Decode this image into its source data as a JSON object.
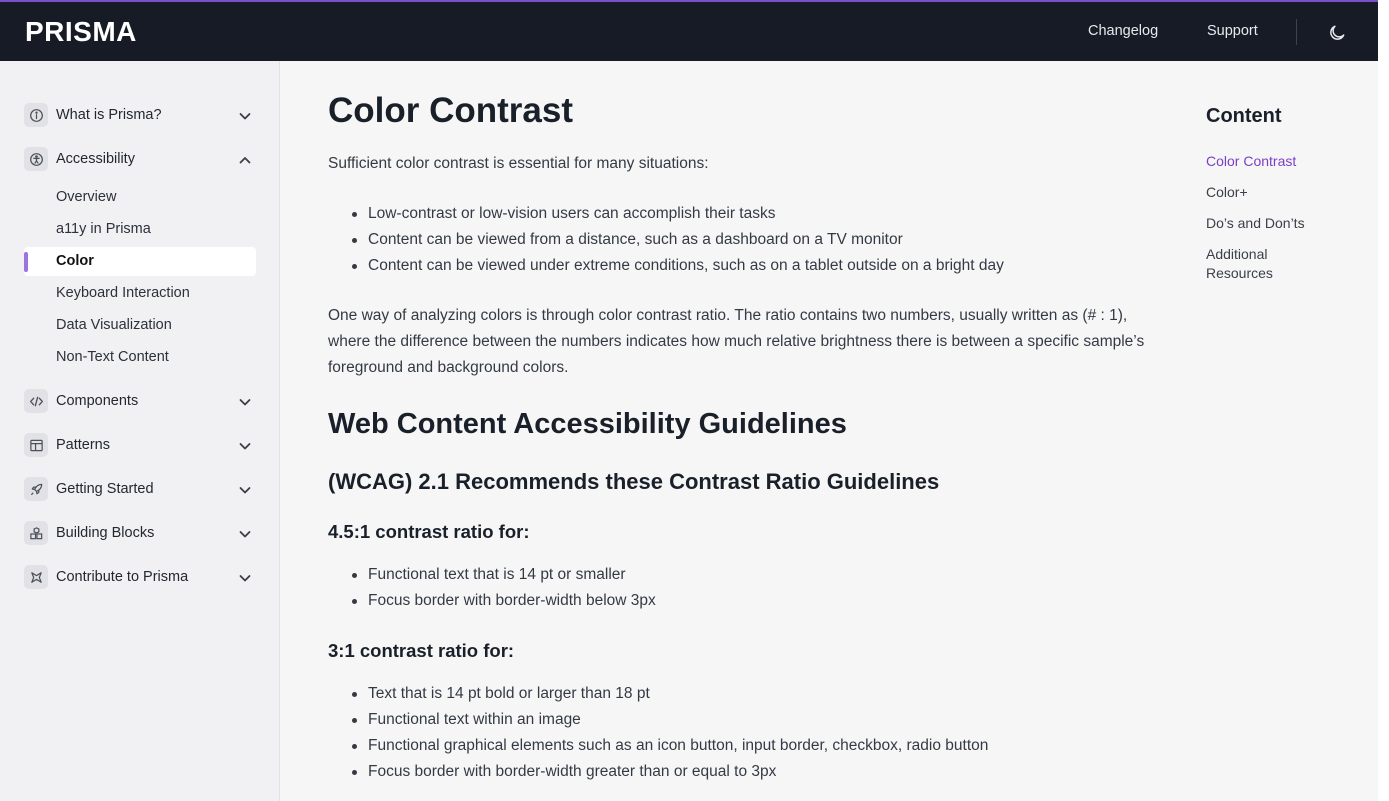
{
  "header": {
    "logo": "PRISMA",
    "links": [
      "Changelog",
      "Support"
    ],
    "theme_toggle_icon": "moon-icon"
  },
  "sidebar": {
    "groups": [
      {
        "label": "What is Prisma?",
        "icon": "info-icon",
        "expanded": false
      },
      {
        "label": "Accessibility",
        "icon": "accessibility-icon",
        "expanded": true
      },
      {
        "label": "Components",
        "icon": "code-icon",
        "expanded": false
      },
      {
        "label": "Patterns",
        "icon": "layout-icon",
        "expanded": false
      },
      {
        "label": "Getting Started",
        "icon": "rocket-icon",
        "expanded": false
      },
      {
        "label": "Building Blocks",
        "icon": "blocks-icon",
        "expanded": false
      },
      {
        "label": "Contribute to Prisma",
        "icon": "contribute-icon",
        "expanded": false
      }
    ],
    "accessibility_items": [
      "Overview",
      "a11y in Prisma",
      "Color",
      "Keyboard Interaction",
      "Data Visualization",
      "Non-Text Content"
    ],
    "active_item": "Color"
  },
  "main": {
    "title": "Color Contrast",
    "intro": "Sufficient color contrast is essential for many situations:",
    "situations": [
      "Low-contrast or low-vision users can accomplish their tasks",
      "Content can be viewed from a distance, such as a dashboard on a TV monitor",
      "Content can be viewed under extreme conditions, such as on a tablet outside on a bright day"
    ],
    "ratio_paragraph": "One way of analyzing colors is through color contrast ratio. The ratio contains two numbers, usually written as (# : 1), where the difference between the numbers indicates how much relative brightness there is between a specific sample’s foreground and background colors.",
    "wcag_heading": "Web Content Accessibility Guidelines",
    "wcag_subheading": "(WCAG) 2.1 Recommends these Contrast Ratio Guidelines",
    "ratio_45": {
      "heading": "4.5:1 contrast ratio for:",
      "items": [
        "Functional text that is 14 pt or smaller",
        "Focus border with border-width below 3px"
      ]
    },
    "ratio_3": {
      "heading": "3:1 contrast ratio for:",
      "items": [
        "Text that is 14 pt bold or larger than 18 pt",
        "Functional text within an image",
        "Functional graphical elements such as an icon button, input border, checkbox, radio button",
        "Focus border with border-width greater than or equal to 3px"
      ]
    }
  },
  "toc": {
    "title": "Content",
    "links": [
      "Color Contrast",
      "Color+",
      "Do’s and Don’ts",
      "Additional Resources"
    ],
    "active": "Color Contrast"
  },
  "colors": {
    "header_bg": "#161b25",
    "accent": "#7b3fc8",
    "active_marker": "#9b74e0",
    "page_bg": "#f6f6f7"
  }
}
